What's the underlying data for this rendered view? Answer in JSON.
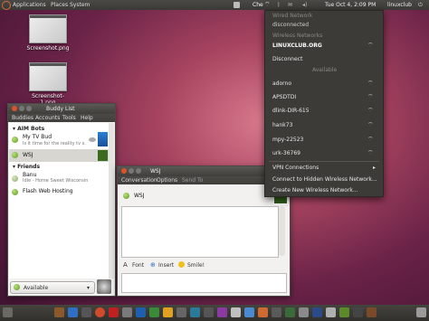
{
  "panel": {
    "menus": [
      "Applications",
      "Places",
      "System"
    ],
    "che": "Che",
    "clock": "Tue Oct 4, 2:09 PM",
    "user": "linuxclub"
  },
  "desktop": {
    "icons": [
      {
        "label": "Screenshot.png"
      },
      {
        "label": "Screenshot-1.png"
      }
    ]
  },
  "buddy_list": {
    "title": "Buddy List",
    "menu": [
      "Buddies",
      "Accounts",
      "Tools",
      "Help"
    ],
    "groups": [
      {
        "name": "AIM Bots",
        "buddies": [
          {
            "name": "My TV Bud",
            "status": "Is it time for the reality tv s..."
          },
          {
            "name": "WSJ",
            "status": ""
          }
        ]
      },
      {
        "name": "Friends",
        "buddies": [
          {
            "name": "Banu",
            "status": "Idle - Home Sweet Wisconsin"
          },
          {
            "name": "Flash Web Hosting",
            "status": ""
          }
        ]
      }
    ],
    "status_value": "Available"
  },
  "chat": {
    "title": "WSJ",
    "menu": [
      "Conversation",
      "Options",
      "Send To"
    ],
    "buddy": "WSJ",
    "toolbar": {
      "font": "Font",
      "insert": "Insert",
      "smile": "Smile!"
    }
  },
  "network_menu": {
    "wired_header": "Wired Network",
    "wired_status": "disconnected",
    "wireless_header": "Wireless Networks",
    "current": "LINUXCLUB.ORG",
    "disconnect": "Disconnect",
    "available_header": "Available",
    "networks": [
      "adorno",
      "APSDTDI",
      "dlink-DIR-615",
      "hank73",
      "mpy-22523",
      "urk-36769"
    ],
    "vpn": "VPN Connections",
    "connect_hidden": "Connect to Hidden Wireless Network...",
    "create_new": "Create New Wireless Network..."
  },
  "colors": {
    "accent": "#e06a38",
    "panel": "#3c3b37",
    "status_green": "#5b9b1f"
  }
}
